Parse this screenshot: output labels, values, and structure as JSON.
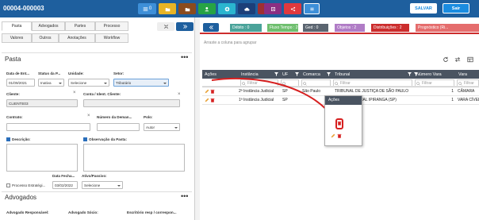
{
  "header": {
    "case_id": "00004-000003",
    "buttons": [
      {
        "icon": "list-icon",
        "label": "0",
        "color": "#3d8fd8"
      },
      {
        "icon": "folder-plus-icon",
        "label": "",
        "color": "#e8b425"
      },
      {
        "icon": "folder-add-icon",
        "label": "",
        "color": "#8a4b1e"
      },
      {
        "icon": "user-add-icon",
        "label": "",
        "color": "#27a344"
      },
      {
        "icon": "plus-circle-icon",
        "label": "",
        "color": "#2ab5cf"
      },
      {
        "icon": "cloud-icon",
        "label": "",
        "color": "#1c3f79"
      },
      {
        "icon": "bag-icon",
        "label": "",
        "color": "#a03030"
      },
      {
        "icon": "expand-icon",
        "label": "",
        "color": "#8b2f82"
      },
      {
        "icon": "share-icon",
        "label": "",
        "color": "#e0393e"
      },
      {
        "icon": "menu-icon",
        "label": "",
        "color": "#3d8fd8"
      }
    ],
    "save_label": "SALVAR",
    "exit_label": "Sair"
  },
  "tabs": [
    "Pasta",
    "Advogados",
    "Partes",
    "Processo",
    "Valores",
    "Outros",
    "Anotações",
    "Workflow"
  ],
  "pasta": {
    "title": "Pasta",
    "date_label": "Data de Ent...",
    "date_value": "01/09/2021",
    "status_label": "Status da P...",
    "status_value": "Inativa",
    "unit_label": "Unidade:",
    "unit_value": "Selecione",
    "sector_label": "Setor:",
    "sector_value": "Tributário",
    "client_label": "Cliente:",
    "client_value": "CLIENTE03",
    "account_label": "Conta / Ident. Cliente:",
    "contract_label": "Contrato:",
    "demand_label": "Número da Deman...",
    "pole_label": "Polo:",
    "pole_value": "Autor",
    "description_label": "Descrição:",
    "observation_label": "Observação da Pasta:",
    "strategic_label": "Processo Estratégi...",
    "close_date_label": "Data Fecha...",
    "close_date_value": "03/02/2022",
    "active_label": "Ativo/Passivo:",
    "active_value": "Selecione"
  },
  "advogados": {
    "title": "Advogados",
    "responsible_label": "Advogado Responsável:",
    "partner_label": "Advogado Sócio:",
    "office_label": "Escritório resp / correspon..."
  },
  "panel_tabs": [
    {
      "label": "Débito",
      "count": "0",
      "color": "#4aa39a"
    },
    {
      "label": "Fluxo Tempo",
      "count": "2",
      "color": "#6fbf6f"
    },
    {
      "label": "Ged",
      "count": "0",
      "color": "#5b6570"
    },
    {
      "label": "Objetos",
      "count": "2",
      "color": "#b07cc6"
    },
    {
      "label": "Distribuições",
      "count": "2",
      "color": "#cc2d2d"
    },
    {
      "label": "Prognóstico (Ri...",
      "count": "",
      "color": "#e56d6d"
    }
  ],
  "grid": {
    "group_hint": "Arraste a coluna para agrupar",
    "columns": [
      "Ações",
      "Instância",
      "UF",
      "Comarca",
      "Tribunal",
      "Número Vara",
      "Vara"
    ],
    "filter_placeholder": "Filtrar",
    "rows": [
      {
        "instancia": "2ª Instância Judicial",
        "uf": "SP",
        "comarca": "São Paulo",
        "tribunal": "TRIBUNAL DE JUSTIÇA DE SÃO PAULO",
        "numero_vara": "1",
        "vara": "CÂMARA"
      },
      {
        "instancia": "1ª Instância Judicial",
        "uf": "SP",
        "comarca": "",
        "tribunal": "FORO REGIONAL IPIRANGA (SP)",
        "numero_vara": "1",
        "vara": "VARA CÍVEL"
      }
    ]
  },
  "popup": {
    "title": "Ações"
  },
  "colors": {
    "header": "#1e5f9e",
    "save": "#1a8ce0",
    "grid_header": "#4a5461",
    "accent_red": "#d62020"
  }
}
